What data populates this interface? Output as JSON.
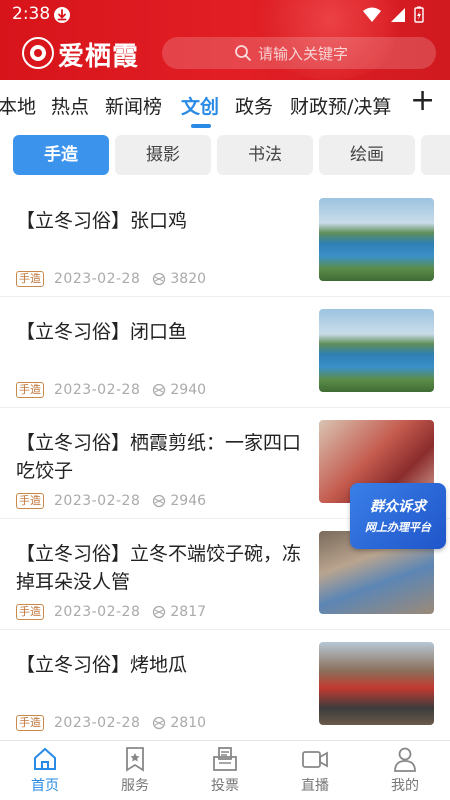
{
  "status": {
    "time": "2:38"
  },
  "header": {
    "brand": "爱栖霞",
    "search_placeholder": "请输入关键字",
    "bg_color": "#d8141b"
  },
  "nav": {
    "tabs": [
      {
        "label": "本地"
      },
      {
        "label": "热点"
      },
      {
        "label": "新闻榜"
      },
      {
        "label": "文创",
        "active": true
      },
      {
        "label": "政务"
      },
      {
        "label": "财政预/决算"
      }
    ],
    "plus": "+",
    "accent": "#2a8be6"
  },
  "subtabs": [
    {
      "label": "手造",
      "active": true
    },
    {
      "label": "摄影"
    },
    {
      "label": "书法"
    },
    {
      "label": "绘画"
    }
  ],
  "articles": [
    {
      "title": "【立冬习俗】张口鸡",
      "tag": "手造",
      "date": "2023-02-28",
      "views": "3820",
      "image": "lake-landscape"
    },
    {
      "title": "【立冬习俗】闭口鱼",
      "tag": "手造",
      "date": "2023-02-28",
      "views": "2940",
      "image": "lake-landscape"
    },
    {
      "title": "【立冬习俗】栖霞剪纸：一家四口吃饺子",
      "tag": "手造",
      "date": "2023-02-28",
      "views": "2946",
      "image": "elderly-woman-papercut"
    },
    {
      "title": "【立冬习俗】立冬不端饺子碗，冻掉耳朵没人管",
      "tag": "手造",
      "date": "2023-02-28",
      "views": "2817",
      "image": "person-cooking"
    },
    {
      "title": "【立冬习俗】烤地瓜",
      "tag": "手造",
      "date": "2023-02-28",
      "views": "2810",
      "image": "street-market"
    }
  ],
  "float_banner": {
    "line1": "群众诉求",
    "line2": "网上办理平台"
  },
  "bottom_nav": [
    {
      "label": "首页",
      "icon": "home-icon",
      "active": true
    },
    {
      "label": "服务",
      "icon": "bookmark-star-icon"
    },
    {
      "label": "投票",
      "icon": "ballot-box-icon"
    },
    {
      "label": "直播",
      "icon": "video-camera-icon"
    },
    {
      "label": "我的",
      "icon": "person-icon"
    }
  ]
}
